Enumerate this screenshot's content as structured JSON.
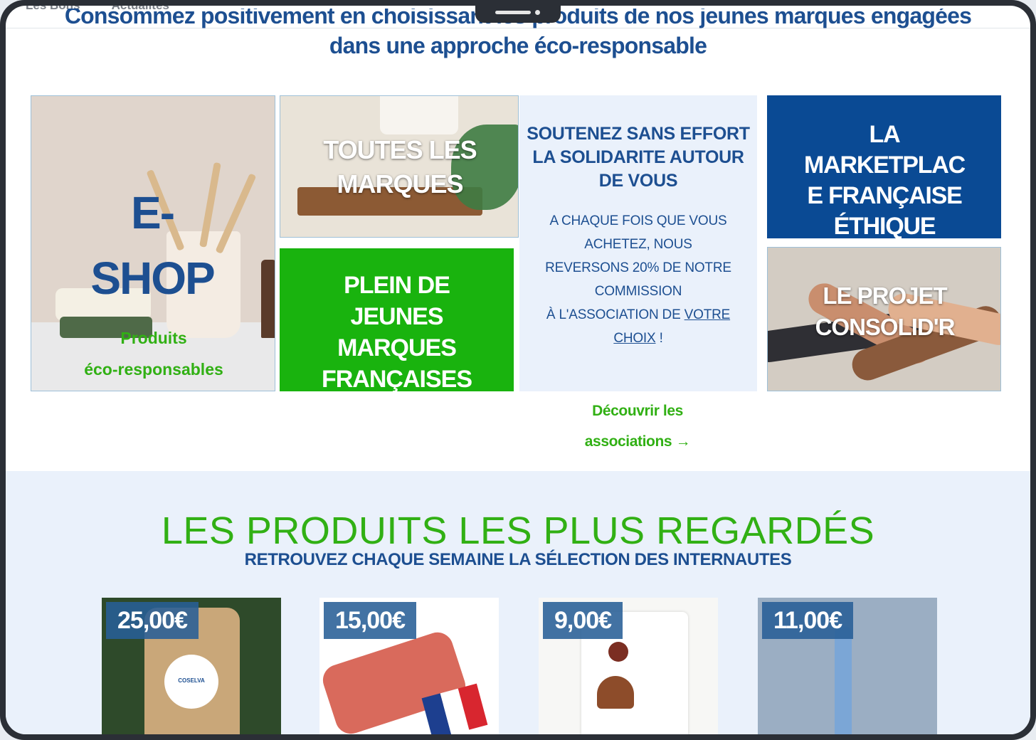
{
  "topnav": {
    "items": [
      "Les Bons",
      "Actualités"
    ]
  },
  "headline": {
    "line1": "Consommez positivement en choisissant les produits de nos jeunes marques engagées",
    "line2": "dans une approche éco-responsable"
  },
  "tiles": {
    "eshop": {
      "title": "E-SHOP",
      "title_a": "E-",
      "title_b": "SHOP",
      "sub_a": "Produits",
      "sub_b": "éco-responsables"
    },
    "marques": {
      "label_a": "TOUTES LES",
      "label_b": "MARQUES"
    },
    "plein": {
      "label_a": "PLEIN DE",
      "label_b": "JEUNES",
      "label_c": "MARQUES",
      "label_d": "FRANÇAISES"
    },
    "soutenez": {
      "h1": "SOUTENEZ SANS EFFORT",
      "h2": "LA SOLIDARITE AUTOUR",
      "h3": "DE VOUS",
      "p1": "A CHAQUE FOIS QUE VOUS",
      "p2": "ACHETEZ, NOUS",
      "p3": "REVERSONS 20% DE NOTRE",
      "p4": "COMMISSION",
      "p5": "À L'ASSOCIATION DE ",
      "link_a": "VOTRE",
      "link_b": "CHOIX",
      "p6": " !"
    },
    "market": {
      "label_a": "LA",
      "label_b": "MARKETPLAC",
      "label_c": "E FRANÇAISE",
      "label_d": "ÉTHIQUE"
    },
    "projet": {
      "label_a": "LE PROJET",
      "label_b": "CONSOLID'R"
    }
  },
  "decouvrir": {
    "line1": "Découvrir les",
    "line2": "associations",
    "arrow": "→"
  },
  "section2": {
    "title": "LES PRODUITS LES PLUS REGARDÉS",
    "subtitle": "RETROUVEZ CHAQUE SEMAINE LA SÉLECTION DES INTERNAUTES"
  },
  "products": [
    {
      "price": "25,00€",
      "brand": "COSELVA"
    },
    {
      "price": "15,00€"
    },
    {
      "price": "9,00€"
    },
    {
      "price": "11,00€"
    }
  ],
  "colors": {
    "brand_blue": "#1d4f91",
    "brand_green": "#31b014",
    "tile_green": "#19b30e",
    "tile_blue": "#0a4a94",
    "light_bg": "#eaf1fb"
  }
}
